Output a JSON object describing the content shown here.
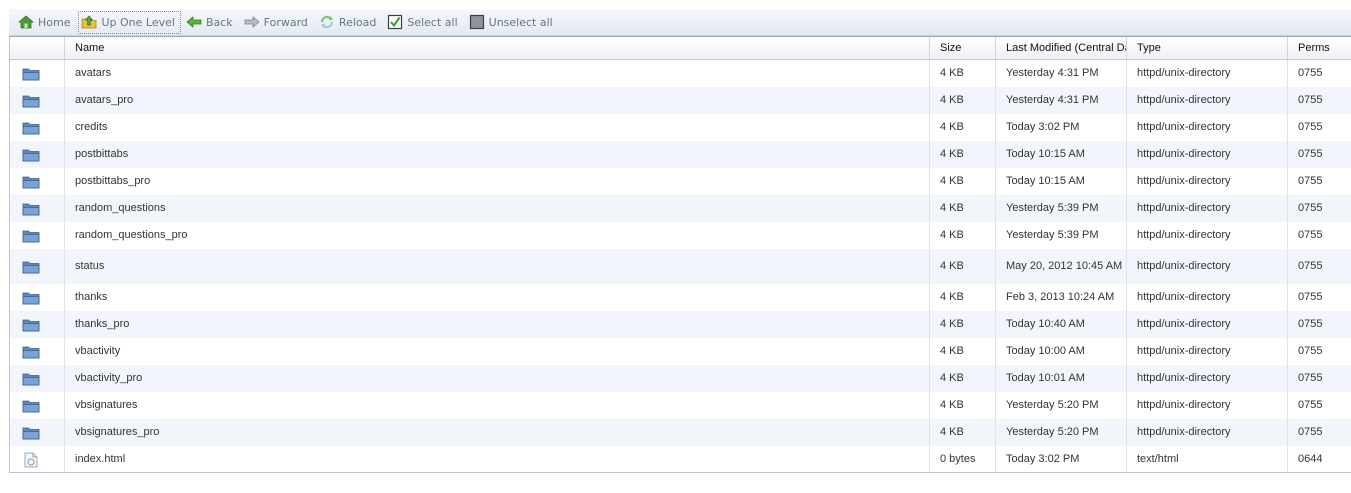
{
  "toolbar": {
    "home": "Home",
    "up": "Up One Level",
    "back": "Back",
    "forward": "Forward",
    "reload": "Reload",
    "select_all": "Select all",
    "unselect_all": "Unselect all"
  },
  "columns": {
    "name": "Name",
    "size": "Size",
    "modified": "Last Modified (Central Da",
    "type": "Type",
    "perms": "Perms"
  },
  "rows": [
    {
      "kind": "folder",
      "name": "avatars",
      "size": "4 KB",
      "modified": "Yesterday 4:31 PM",
      "type": "httpd/unix-directory",
      "perms": "0755"
    },
    {
      "kind": "folder",
      "name": "avatars_pro",
      "size": "4 KB",
      "modified": "Yesterday 4:31 PM",
      "type": "httpd/unix-directory",
      "perms": "0755"
    },
    {
      "kind": "folder",
      "name": "credits",
      "size": "4 KB",
      "modified": "Today 3:02 PM",
      "type": "httpd/unix-directory",
      "perms": "0755"
    },
    {
      "kind": "folder",
      "name": "postbittabs",
      "size": "4 KB",
      "modified": "Today 10:15 AM",
      "type": "httpd/unix-directory",
      "perms": "0755"
    },
    {
      "kind": "folder",
      "name": "postbittabs_pro",
      "size": "4 KB",
      "modified": "Today 10:15 AM",
      "type": "httpd/unix-directory",
      "perms": "0755"
    },
    {
      "kind": "folder",
      "name": "random_questions",
      "size": "4 KB",
      "modified": "Yesterday 5:39 PM",
      "type": "httpd/unix-directory",
      "perms": "0755"
    },
    {
      "kind": "folder",
      "name": "random_questions_pro",
      "size": "4 KB",
      "modified": "Yesterday 5:39 PM",
      "type": "httpd/unix-directory",
      "perms": "0755"
    },
    {
      "kind": "folder",
      "name": "status",
      "size": "4 KB",
      "modified": "May 20, 2012 10:45 AM",
      "type": "httpd/unix-directory",
      "perms": "0755"
    },
    {
      "kind": "folder",
      "name": "thanks",
      "size": "4 KB",
      "modified": "Feb 3, 2013 10:24 AM",
      "type": "httpd/unix-directory",
      "perms": "0755"
    },
    {
      "kind": "folder",
      "name": "thanks_pro",
      "size": "4 KB",
      "modified": "Today 10:40 AM",
      "type": "httpd/unix-directory",
      "perms": "0755"
    },
    {
      "kind": "folder",
      "name": "vbactivity",
      "size": "4 KB",
      "modified": "Today 10:00 AM",
      "type": "httpd/unix-directory",
      "perms": "0755"
    },
    {
      "kind": "folder",
      "name": "vbactivity_pro",
      "size": "4 KB",
      "modified": "Today 10:01 AM",
      "type": "httpd/unix-directory",
      "perms": "0755"
    },
    {
      "kind": "folder",
      "name": "vbsignatures",
      "size": "4 KB",
      "modified": "Yesterday 5:20 PM",
      "type": "httpd/unix-directory",
      "perms": "0755"
    },
    {
      "kind": "folder",
      "name": "vbsignatures_pro",
      "size": "4 KB",
      "modified": "Yesterday 5:20 PM",
      "type": "httpd/unix-directory",
      "perms": "0755"
    },
    {
      "kind": "file",
      "name": "index.html",
      "size": "0 bytes",
      "modified": "Today 3:02 PM",
      "type": "text/html",
      "perms": "0644"
    }
  ]
}
